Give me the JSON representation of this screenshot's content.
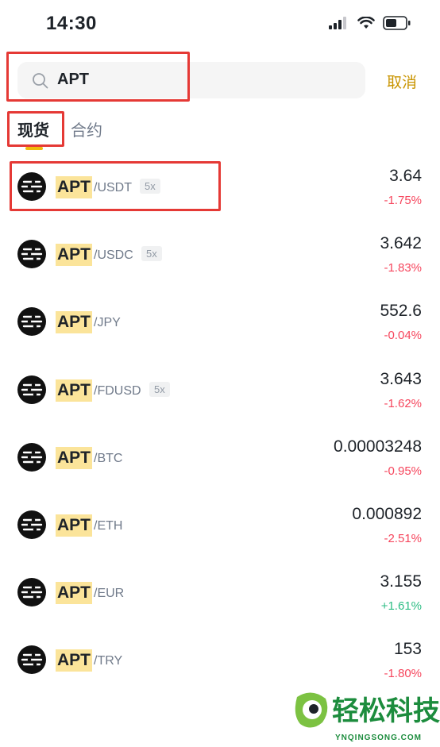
{
  "status_bar": {
    "time": "14:30"
  },
  "search": {
    "query": "APT",
    "cancel_label": "取消"
  },
  "tabs": [
    {
      "label": "现货",
      "active": true
    },
    {
      "label": "合约",
      "active": false
    }
  ],
  "pairs": [
    {
      "base": "APT",
      "quote": "/USDT",
      "leverage": "5x",
      "price": "3.64",
      "change": "-1.75%",
      "direction": "down"
    },
    {
      "base": "APT",
      "quote": "/USDC",
      "leverage": "5x",
      "price": "3.642",
      "change": "-1.83%",
      "direction": "down"
    },
    {
      "base": "APT",
      "quote": "/JPY",
      "leverage": null,
      "price": "552.6",
      "change": "-0.04%",
      "direction": "down"
    },
    {
      "base": "APT",
      "quote": "/FDUSD",
      "leverage": "5x",
      "price": "3.643",
      "change": "-1.62%",
      "direction": "down"
    },
    {
      "base": "APT",
      "quote": "/BTC",
      "leverage": null,
      "price": "0.00003248",
      "change": "-0.95%",
      "direction": "down"
    },
    {
      "base": "APT",
      "quote": "/ETH",
      "leverage": null,
      "price": "0.000892",
      "change": "-2.51%",
      "direction": "down"
    },
    {
      "base": "APT",
      "quote": "/EUR",
      "leverage": null,
      "price": "3.155",
      "change": "+1.61%",
      "direction": "up"
    },
    {
      "base": "APT",
      "quote": "/TRY",
      "leverage": null,
      "price": "153",
      "change": "-1.80%",
      "direction": "down"
    }
  ],
  "colors": {
    "accent": "#f0b90b",
    "cancel": "#c99400",
    "negative": "#f6465d",
    "positive": "#2ebd85",
    "annotation": "#e53935"
  },
  "watermark": {
    "text": "轻松科技",
    "domain": "YNQINGSONG.COM"
  }
}
